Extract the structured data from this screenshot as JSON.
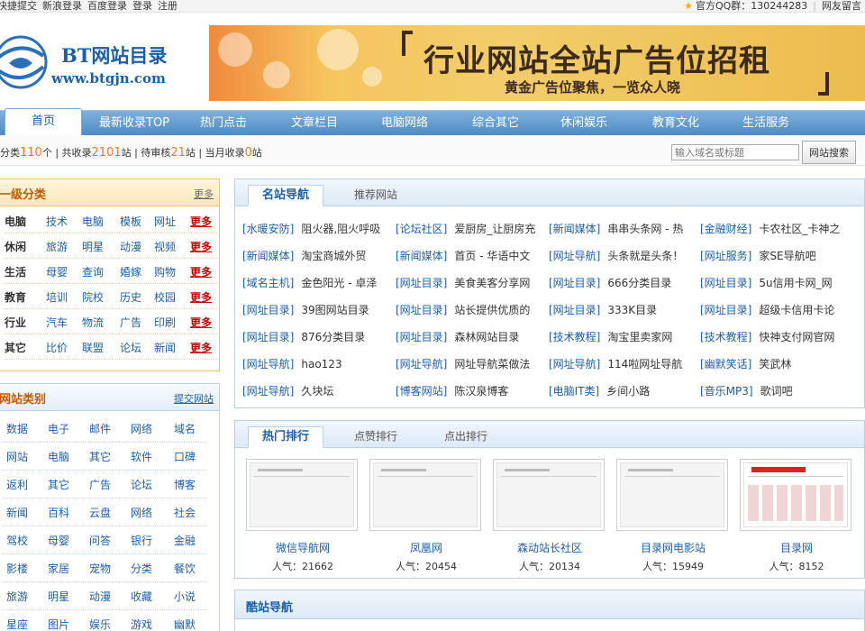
{
  "topbar": {
    "left_links": [
      "快捷提交",
      "新浪登录",
      "百度登录",
      "登录",
      "注册"
    ],
    "qq_group": "官方QQ群：130244283",
    "guestbook": "网友留言"
  },
  "logo": {
    "title": "BT网站目录",
    "url": "www.btgjn.com"
  },
  "banner": {
    "headline": "行业网站全站广告位招租",
    "subline": "黄金广告位聚焦，一览众人晓"
  },
  "nav": {
    "home": "首页",
    "items": [
      "最新收录TOP",
      "热门点击",
      "文章栏目",
      "电脑网络",
      "综合其它",
      "休闲娱乐",
      "教育文化",
      "生活服务"
    ]
  },
  "stats": {
    "p1": "分类",
    "categories": "110",
    "p2": "个 | 共收录",
    "total": "2101",
    "p3": "站 | 待审核",
    "pending": "21",
    "p4": "站 | 当月收录",
    "month": "0",
    "p5": "站",
    "search_placeholder": "输入域名或标题",
    "search_button": "网站搜索"
  },
  "cat_box": {
    "title": "一级分类",
    "more": "更多",
    "more_label": "更多",
    "rows": [
      [
        "电脑",
        "技术",
        "电脑",
        "模板",
        "网址"
      ],
      [
        "休闲",
        "旅游",
        "明星",
        "动漫",
        "视频"
      ],
      [
        "生活",
        "母婴",
        "查询",
        "婚嫁",
        "购物"
      ],
      [
        "教育",
        "培训",
        "院校",
        "历史",
        "校园"
      ],
      [
        "行业",
        "汽车",
        "物流",
        "广告",
        "印刷"
      ],
      [
        "其它",
        "比价",
        "联盟",
        "论坛",
        "新闻"
      ]
    ]
  },
  "site_box": {
    "title": "网站类别",
    "submit": "提交网站",
    "rows": [
      [
        "数据",
        "电子",
        "邮件",
        "网络",
        "域名"
      ],
      [
        "网站",
        "电脑",
        "其它",
        "软件",
        "口碑"
      ],
      [
        "返利",
        "其它",
        "广告",
        "论坛",
        "博客"
      ],
      [
        "新闻",
        "百科",
        "云盘",
        "网络",
        "社会"
      ],
      [
        "驾校",
        "母婴",
        "问答",
        "银行",
        "金融"
      ],
      [
        "影楼",
        "家居",
        "宠物",
        "分类",
        "餐饮"
      ],
      [
        "旅游",
        "明星",
        "动漫",
        "收藏",
        "小说"
      ],
      [
        "星座",
        "图片",
        "娱乐",
        "游戏",
        "幽默"
      ]
    ]
  },
  "famous": {
    "tabs": [
      "名站导航",
      "推荐网站"
    ],
    "rows": [
      [
        [
          "[水暖安防]",
          "阻火器,阻火呼吸"
        ],
        [
          "[论坛社区]",
          "爱厨房_让厨房充"
        ],
        [
          "[新闻媒体]",
          "串串头条网 - 热"
        ],
        [
          "[金融财经]",
          "卡农社区_卡神之"
        ]
      ],
      [
        [
          "[新闻媒体]",
          "淘宝商城外贸"
        ],
        [
          "[新闻媒体]",
          "首页 - 华语中文"
        ],
        [
          "[网址导航]",
          "头条就是头条！"
        ],
        [
          "[网址服务]",
          "家SE导航吧"
        ]
      ],
      [
        [
          "[域名主机]",
          "金色阳光 - 卓泽"
        ],
        [
          "[网址目录]",
          "美食美客分享网"
        ],
        [
          "[网址目录]",
          "666分类目录"
        ],
        [
          "[网址目录]",
          "5u信用卡网_网"
        ]
      ],
      [
        [
          "[网址目录]",
          "39图网站目录"
        ],
        [
          "[网址目录]",
          "站长提供优质的"
        ],
        [
          "[网址目录]",
          "333K目录"
        ],
        [
          "[网址目录]",
          "超级卡信用卡论"
        ]
      ],
      [
        [
          "[网址目录]",
          "876分类目录"
        ],
        [
          "[网址目录]",
          "森林网站目录"
        ],
        [
          "[技术教程]",
          "淘宝里卖家网"
        ],
        [
          "[技术教程]",
          "快神支付网官网"
        ]
      ],
      [
        [
          "[网址导航]",
          "hao123"
        ],
        [
          "[网址导航]",
          "网址导航菜做法"
        ],
        [
          "[网址导航]",
          "114啦网址导航"
        ],
        [
          "[幽默笑话]",
          "笑武林"
        ]
      ],
      [
        [
          "[网址导航]",
          "久块坛"
        ],
        [
          "[博客网站]",
          "陈汉泉博客"
        ],
        [
          "[电脑IT类]",
          "乡间小路"
        ],
        [
          "[音乐MP3]",
          "歌词吧"
        ]
      ]
    ]
  },
  "hot": {
    "tabs": [
      "热门排行",
      "点赞排行",
      "点出排行"
    ],
    "items": [
      {
        "name": "微信导航网",
        "pop": "人气：21662"
      },
      {
        "name": "凤凰网",
        "pop": "人气：20454"
      },
      {
        "name": "森动站长社区",
        "pop": "人气：20134"
      },
      {
        "name": "目录网电影站",
        "pop": "人气：15949"
      },
      {
        "name": "目录网",
        "pop": "人气：8152"
      }
    ]
  },
  "cool": {
    "title": "酷站导航"
  },
  "colors": {
    "accent": "#1d5ea8",
    "nav": "#4f8cc4",
    "orange": "#f07a2a",
    "more": "#cc0000"
  }
}
